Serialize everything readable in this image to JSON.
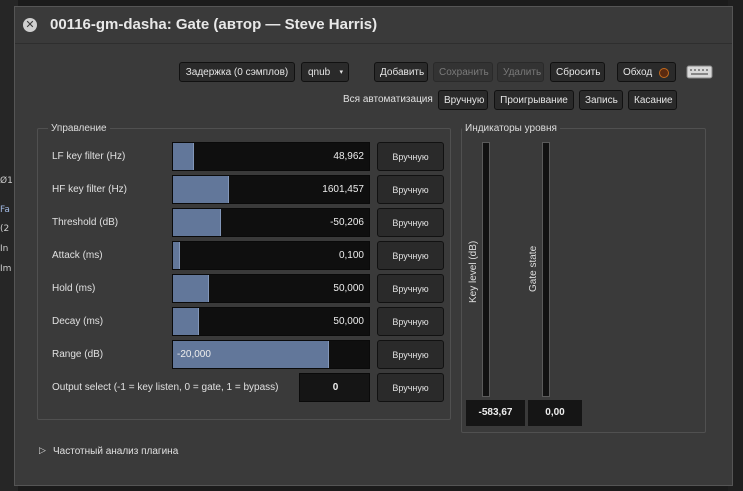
{
  "window": {
    "title": "00116-gm-dasha: Gate (автор — Steve Harris)",
    "close_icon": "x-icon"
  },
  "toolbar": {
    "latency_label": "Задержка (0 сэмплов)",
    "preset_value": "qnub",
    "add_label": "Добавить",
    "save_label": "Сохранить",
    "delete_label": "Удалить",
    "reset_label": "Сбросить",
    "bypass_label": "Обход",
    "keyboard_icon": "keyboard-icon"
  },
  "automation": {
    "all_label": "Вся автоматизация",
    "manual_label": "Вручную",
    "play_label": "Проигрывание",
    "write_label": "Запись",
    "touch_label": "Касание"
  },
  "controls": {
    "title": "Управление",
    "manual_btn": "Вручную",
    "params": [
      {
        "label": "LF key filter (Hz)",
        "value": "48,962",
        "fill": 0.1
      },
      {
        "label": "HF key filter (Hz)",
        "value": "1601,457",
        "fill": 0.28
      },
      {
        "label": "Threshold (dB)",
        "value": "-50,206",
        "fill": 0.24
      },
      {
        "label": "Attack (ms)",
        "value": "0,100",
        "fill": 0.03
      },
      {
        "label": "Hold (ms)",
        "value": "50,000",
        "fill": 0.18
      },
      {
        "label": "Decay (ms)",
        "value": "50,000",
        "fill": 0.13
      },
      {
        "label": "Range (dB)",
        "value": "-20,000",
        "fill": 0.79
      },
      {
        "label": "Output select (-1 = key listen, 0 = gate, 1 = bypass)",
        "value": "0"
      }
    ]
  },
  "meters": {
    "title": "Индикаторы уровня",
    "key_level_label": "Key level (dB)",
    "key_level_value": "-583,67",
    "gate_state_label": "Gate state",
    "gate_state_value": "0,00"
  },
  "analysis": {
    "label": "Частотный анализ плагина",
    "expander_icon": "triangle-right-icon"
  },
  "background": {
    "chips": [
      "Ø1",
      "Fa",
      "(2",
      "In",
      "Im"
    ]
  }
}
